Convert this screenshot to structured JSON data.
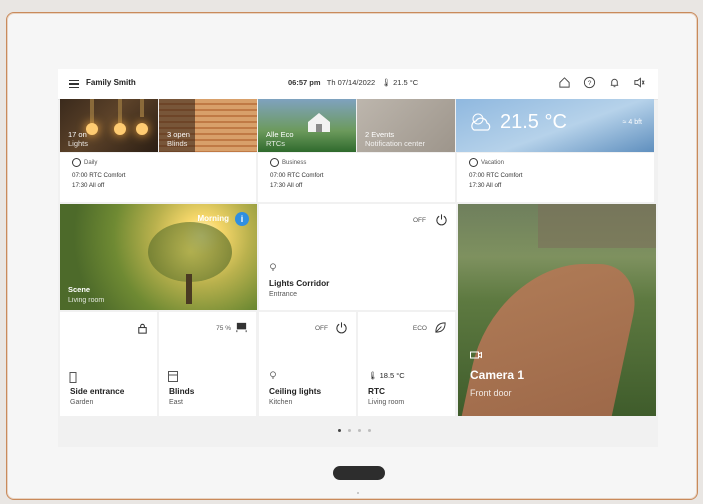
{
  "header": {
    "title": "Family Smith",
    "time": "06:57 pm",
    "date": "Th 07/14/2022",
    "temperature": "21.5 °C"
  },
  "top_tiles": {
    "lights": {
      "line1": "17 on",
      "line2": "Lights"
    },
    "blinds": {
      "line1": "3 open",
      "line2": "Blinds"
    },
    "alle": {
      "line1": "Alle Eco",
      "line2": "RTCs"
    },
    "events": {
      "line1": "2 Events",
      "line2": "Notification center"
    },
    "weather": {
      "temp": "21.5 °C",
      "wind": "4 bft"
    }
  },
  "schedules": [
    {
      "title": "Daily",
      "line1": "07:00 RTC Comfort",
      "line2": "17:30 All off"
    },
    {
      "title": "Business",
      "line1": "07:00 RTC Comfort",
      "line2": "17:30 All off"
    },
    {
      "title": "Vacation",
      "line1": "07:00 RTC Comfort",
      "line2": "17:30 All off"
    }
  ],
  "scene": {
    "badge": "Morning",
    "info": "i",
    "name": "Scene",
    "room": "Living room"
  },
  "corridor": {
    "state": "OFF",
    "name": "Lights Corridor",
    "room": "Entrance"
  },
  "camera": {
    "name": "Camera 1",
    "room": "Front door"
  },
  "small_tiles": [
    {
      "state": "",
      "name": "Side entrance",
      "room": "Garden"
    },
    {
      "state": "75 %",
      "name": "Blinds",
      "room": "East"
    },
    {
      "state": "OFF",
      "name": "Ceiling lights",
      "room": "Kitchen"
    },
    {
      "state": "ECO",
      "value": "18.5 °C",
      "name": "RTC",
      "room": "Living room"
    }
  ],
  "pager": {
    "pages": 4,
    "active": 1
  },
  "icons": [
    "menu-icon",
    "home-icon",
    "help-icon",
    "bell-icon",
    "speaker-icon",
    "power-icon",
    "lock-icon",
    "blind-icon",
    "leaf-icon",
    "thermometer-icon",
    "bulb-icon",
    "camera-icon",
    "door-icon"
  ]
}
